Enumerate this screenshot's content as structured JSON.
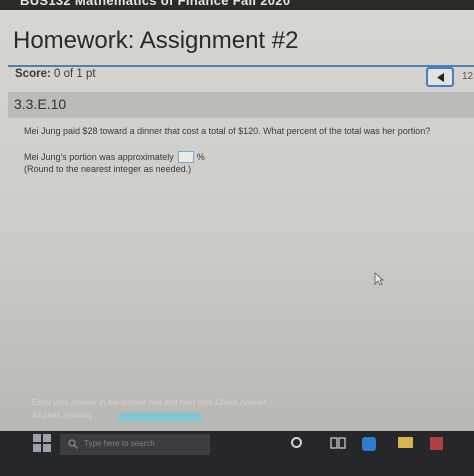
{
  "browser": {
    "course_title": "BUS132 Mathematics of Finance Fall 2020"
  },
  "page": {
    "title": "Homework: Assignment #2",
    "score_label": "Score:",
    "score_value": "0 of 1 pt",
    "page_indicator": "12",
    "question_id": "3.3.E.10"
  },
  "question": {
    "text": "Mei Jung paid $28 toward a dinner that cost a total of $120. What percent of the total was her portion?",
    "answer_prefix": "Mei Jung's portion was approximately",
    "answer_value": "",
    "answer_suffix": "%",
    "rounding_note": "(Round to the nearest integer as needed.)"
  },
  "footer": {
    "hint": "Enter your answer in the answer box and then click Check Answer.",
    "parts_label": "All parts showing",
    "progress_fraction": 1.0
  },
  "taskbar": {
    "search_placeholder": "Type here to search"
  },
  "colors": {
    "accent": "#3f80c8",
    "progress": "#7fc7d8",
    "taskbar": "#26272b"
  },
  "icons": [
    "windows-start-icon",
    "search-icon",
    "cortana-icon",
    "task-view-icon",
    "edge-icon",
    "file-explorer-icon",
    "store-icon",
    "back-arrow-icon",
    "mouse-cursor-icon"
  ]
}
